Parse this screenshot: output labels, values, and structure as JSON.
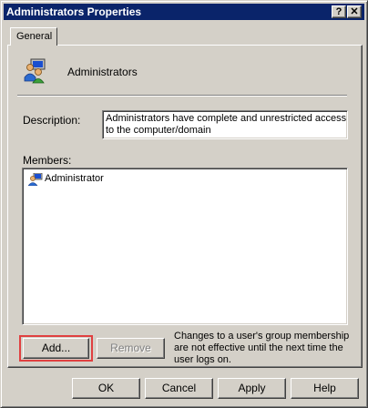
{
  "window": {
    "title": "Administrators Properties",
    "help_glyph": "?",
    "close_glyph": "✕"
  },
  "tabs": [
    {
      "label": "General"
    }
  ],
  "group": {
    "name": "Administrators"
  },
  "description": {
    "label": "Description:",
    "line1": "Administrators have complete and unrestricted access",
    "line2": "to the computer/domain"
  },
  "members": {
    "label": "Members:",
    "items": [
      {
        "name": "Administrator"
      }
    ]
  },
  "buttons": {
    "add": "Add...",
    "remove": "Remove"
  },
  "note": {
    "line1": "Changes to a user's group membership",
    "line2": "are not effective until the next time the",
    "line3": "user logs on."
  },
  "footer": {
    "ok": "OK",
    "cancel": "Cancel",
    "apply": "Apply",
    "help": "Help"
  },
  "colors": {
    "titlebar": "#0a246a",
    "highlight_box": "#e04040"
  }
}
